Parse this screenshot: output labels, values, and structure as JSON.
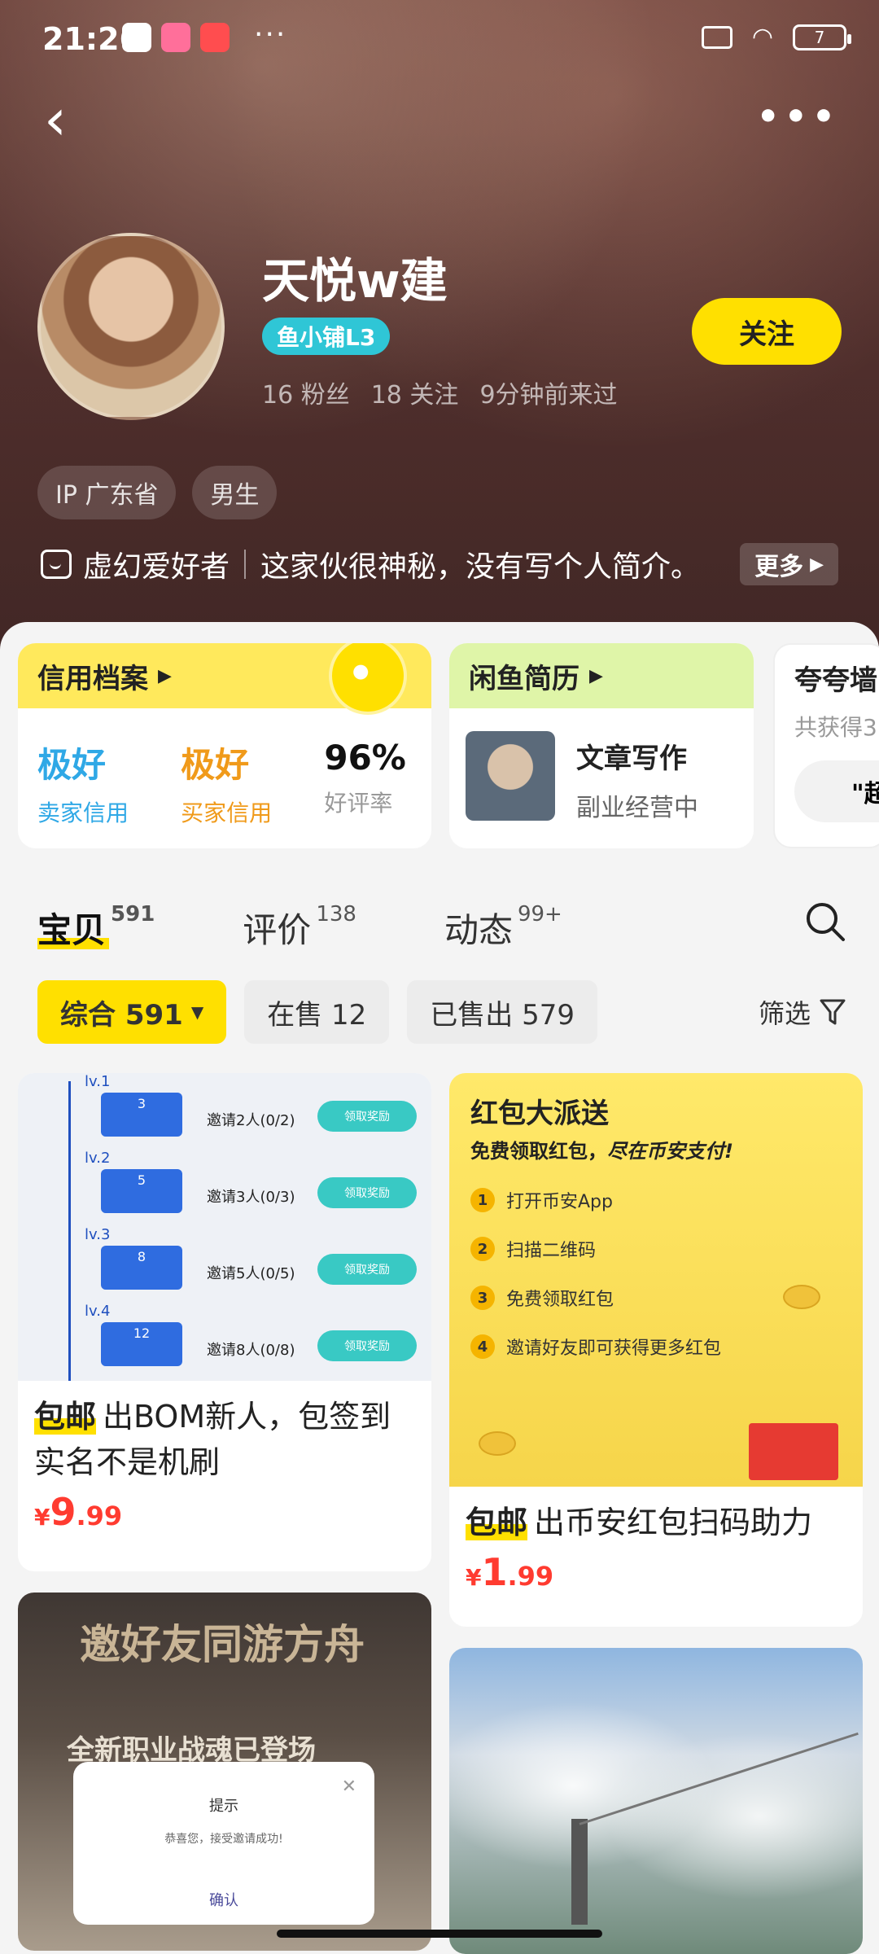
{
  "status": {
    "time": "21:26",
    "battery": "7"
  },
  "profile": {
    "name": "天悦w建",
    "level_badge": "鱼小铺L3",
    "fans": "16 粉丝",
    "following": "18 关注",
    "last_seen": "9分钟前来过",
    "follow_label": "关注",
    "tags": [
      "IP 广东省",
      "男生"
    ],
    "hobby": "虚幻爱好者",
    "bio": "这家伙很神秘，没有写个人简介。",
    "bio_more": "更多"
  },
  "cards": {
    "credit": {
      "title": "信用档案",
      "seller_value": "极好",
      "seller_label": "卖家信用",
      "buyer_value": "极好",
      "buyer_label": "买家信用",
      "rate_value": "96%",
      "rate_label": "好评率"
    },
    "resume": {
      "title": "闲鱼简历",
      "item_title": "文章写作",
      "item_sub": "副业经营中"
    },
    "praise": {
      "title": "夸夸墙",
      "sub": "共获得3",
      "pill": "\"超"
    }
  },
  "tabs": [
    {
      "label": "宝贝",
      "count": "591"
    },
    {
      "label": "评价",
      "count": "138"
    },
    {
      "label": "动态",
      "count": "99+"
    }
  ],
  "filters": {
    "all": "综合 591",
    "on_sale": "在售 12",
    "sold": "已售出 579",
    "filter_label": "筛选"
  },
  "products": [
    {
      "tag": "包邮",
      "title": "出BOM新人，包签到实名不是机刷",
      "price_int": "9",
      "price_dec": ".99",
      "image": {
        "levels": [
          {
            "lv": "lv.1",
            "num": "3",
            "text": "邀请2人(0/2)",
            "btn": "领取奖励"
          },
          {
            "lv": "lv.2",
            "num": "5",
            "text": "邀请3人(0/3)",
            "btn": "领取奖励"
          },
          {
            "lv": "lv.3",
            "num": "8",
            "text": "邀请5人(0/5)",
            "btn": "领取奖励"
          },
          {
            "lv": "lv.4",
            "num": "12",
            "text": "邀请8人(0/8)",
            "btn": "领取奖励"
          }
        ]
      }
    },
    {
      "tag": "包邮",
      "title": "出币安红包扫码助力",
      "price_int": "1",
      "price_dec": ".99",
      "image": {
        "title": "红包大派送",
        "sub_bold": "免费领取红包，",
        "sub_italic": "尽在币安支付!",
        "steps": [
          "打开币安App",
          "扫描二维码",
          "免费领取红包",
          "邀请好友即可获得更多红包"
        ]
      }
    },
    {
      "image": {
        "big": "邀好友同游方舟",
        "mid": "全新职业战魂已登场",
        "dialog_title": "提示",
        "dialog_msg": "恭喜您，接受邀请成功!",
        "dialog_ok": "确认"
      }
    },
    {
      "image": {}
    }
  ],
  "colors": {
    "accent": "#ffe000",
    "price": "#ff3b30",
    "seller_credit": "#2fa8e6",
    "buyer_credit": "#f09a1a"
  }
}
